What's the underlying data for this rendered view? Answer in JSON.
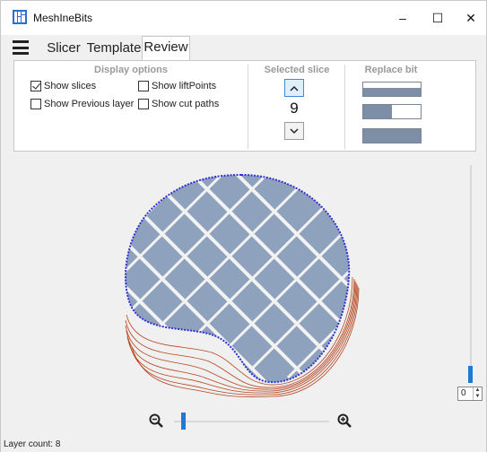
{
  "window": {
    "title": "MeshInеBits",
    "controls": {
      "minimize": "–",
      "maximize": "☐",
      "close": "✕"
    },
    "icons": {
      "app": "app-logo-icon",
      "menu": "hamburger-menu-icon"
    }
  },
  "tabs": [
    {
      "label": "Slicer"
    },
    {
      "label": "Template"
    },
    {
      "label": "Review",
      "active": true
    }
  ],
  "display_options": {
    "title": "Display options",
    "checkboxes": [
      {
        "label": "Show slices",
        "checked": true
      },
      {
        "label": "Show liftPoints",
        "checked": false
      },
      {
        "label": "Show Previous layer",
        "checked": false
      },
      {
        "label": "Show cut paths",
        "checked": false
      }
    ]
  },
  "selected_slice": {
    "title": "Selected slice",
    "value": "9",
    "up_icon": "chevron-up-icon",
    "down_icon": "chevron-down-icon"
  },
  "replace_bit": {
    "title": "Replace bit",
    "bits": [
      {
        "name": "full-length bit",
        "fill_fraction": 1.0,
        "fill_height_fraction": 0.55
      },
      {
        "name": "half-length bit",
        "fill_fraction": 0.5,
        "fill_height_fraction": 1.0
      },
      {
        "name": "full bit",
        "fill_fraction": 1.0,
        "fill_height_fraction": 1.0
      }
    ]
  },
  "viewport": {
    "layer_slider_value": "0",
    "layer_slider_fraction": 0.0,
    "zoom_slider_fraction": 0.05,
    "colors": {
      "bit_fill": "#8ea2bd",
      "outline": "#3030d0",
      "contour": "#b5441f",
      "canvas": "#f0f0f0",
      "accent": "#1f7ad6"
    },
    "zoom_out_icon": "zoom-out-icon",
    "zoom_in_icon": "zoom-in-icon"
  },
  "status": {
    "text": "Layer count: 8"
  }
}
